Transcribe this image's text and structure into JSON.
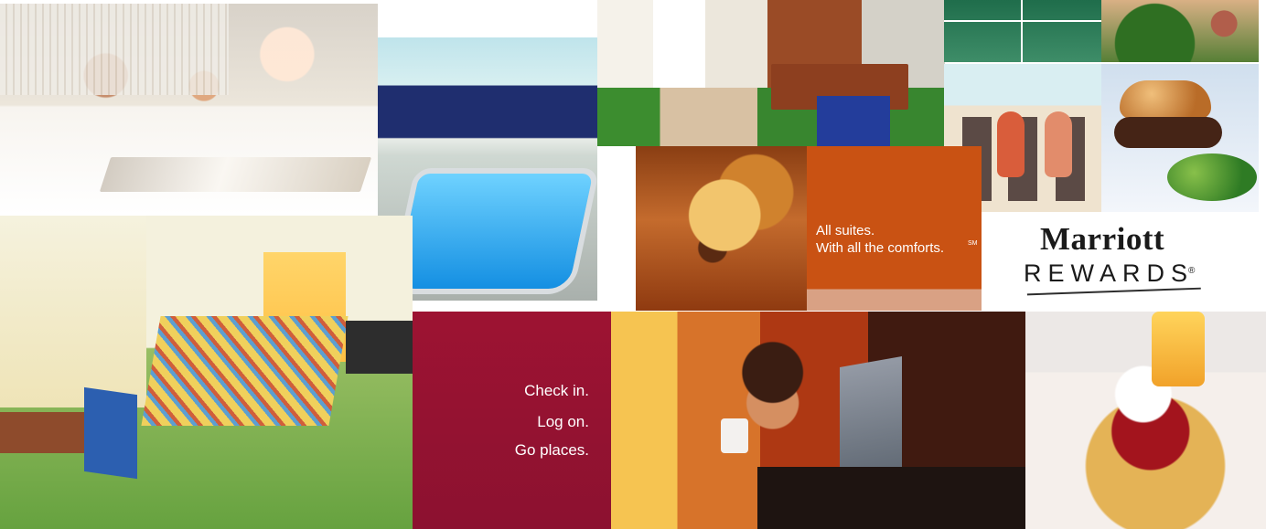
{
  "collage": {
    "orange_promo": {
      "line1": "All suites.",
      "line2": "With all the comforts.",
      "line2_mark": "SM"
    },
    "rewards_logo": {
      "brand": "Marriott",
      "word": "REWARDS",
      "registered_mark": "®"
    },
    "red_promo": {
      "line1": "Check in.",
      "line2": "Log on.",
      "line3": "Go places."
    },
    "colors": {
      "orange_panel": "#C95213",
      "red_panel": "#9D1332",
      "pool_blue": "#148FE2",
      "rewards_text": "#1A1A1A"
    }
  }
}
